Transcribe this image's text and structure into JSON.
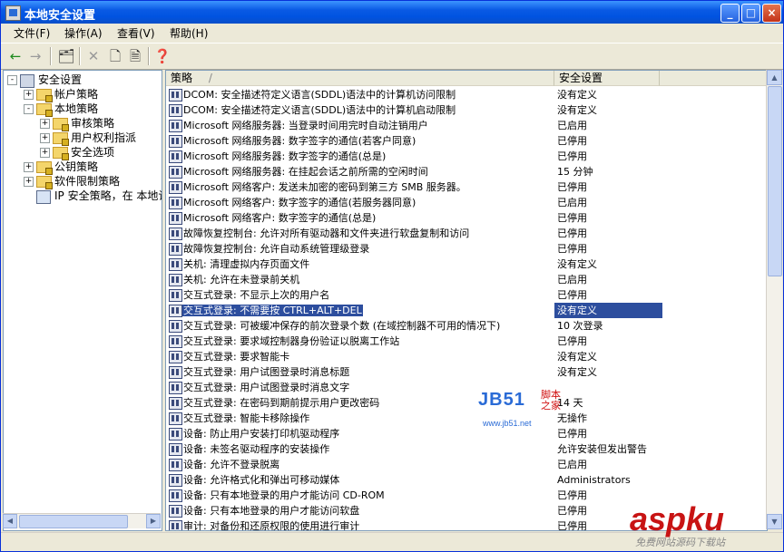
{
  "window": {
    "title": "本地安全设置"
  },
  "menu": [
    "文件(F)",
    "操作(A)",
    "查看(V)",
    "帮助(H)"
  ],
  "tree": [
    {
      "label": "安全设置",
      "level": 0,
      "expander": "-"
    },
    {
      "label": "帐户策略",
      "level": 1,
      "expander": "+"
    },
    {
      "label": "本地策略",
      "level": 1,
      "expander": "-"
    },
    {
      "label": "审核策略",
      "level": 2,
      "expander": "+"
    },
    {
      "label": "用户权利指派",
      "level": 2,
      "expander": "+"
    },
    {
      "label": "安全选项",
      "level": 2,
      "expander": "+"
    },
    {
      "label": "公钥策略",
      "level": 1,
      "expander": "+"
    },
    {
      "label": "软件限制策略",
      "level": 1,
      "expander": "+"
    },
    {
      "label": "IP 安全策略，在 本地计",
      "level": 1,
      "expander": ""
    }
  ],
  "columns": {
    "policy": "策略",
    "sort_indicator": "/",
    "setting": "安全设置"
  },
  "rows": [
    {
      "policy": "DCOM: 安全描述符定义语言(SDDL)语法中的计算机访问限制",
      "setting": "没有定义"
    },
    {
      "policy": "DCOM: 安全描述符定义语言(SDDL)语法中的计算机启动限制",
      "setting": "没有定义"
    },
    {
      "policy": "Microsoft 网络服务器: 当登录时间用完时自动注销用户",
      "setting": "已启用"
    },
    {
      "policy": "Microsoft 网络服务器: 数字签字的通信(若客户同意)",
      "setting": "已停用"
    },
    {
      "policy": "Microsoft 网络服务器: 数字签字的通信(总是)",
      "setting": "已停用"
    },
    {
      "policy": "Microsoft 网络服务器: 在挂起会话之前所需的空闲时间",
      "setting": "15 分钟"
    },
    {
      "policy": "Microsoft 网络客户: 发送未加密的密码到第三方 SMB 服务器。",
      "setting": "已停用"
    },
    {
      "policy": "Microsoft 网络客户: 数字签字的通信(若服务器同意)",
      "setting": "已启用"
    },
    {
      "policy": "Microsoft 网络客户: 数字签字的通信(总是)",
      "setting": "已停用"
    },
    {
      "policy": "故障恢复控制台: 允许对所有驱动器和文件夹进行软盘复制和访问",
      "setting": "已停用"
    },
    {
      "policy": "故障恢复控制台: 允许自动系统管理级登录",
      "setting": "已停用"
    },
    {
      "policy": "关机: 清理虚拟内存页面文件",
      "setting": "没有定义"
    },
    {
      "policy": "关机: 允许在未登录前关机",
      "setting": "已启用"
    },
    {
      "policy": "交互式登录: 不显示上次的用户名",
      "setting": "已停用"
    },
    {
      "policy": "交互式登录: 不需要按 CTRL+ALT+DEL",
      "setting": "没有定义",
      "selected": true
    },
    {
      "policy": "交互式登录: 可被缓冲保存的前次登录个数 (在域控制器不可用的情况下)",
      "setting": "10 次登录"
    },
    {
      "policy": "交互式登录: 要求域控制器身份验证以脱离工作站",
      "setting": "已停用"
    },
    {
      "policy": "交互式登录: 要求智能卡",
      "setting": "没有定义"
    },
    {
      "policy": "交互式登录: 用户试图登录时消息标题",
      "setting": "没有定义"
    },
    {
      "policy": "交互式登录: 用户试图登录时消息文字",
      "setting": ""
    },
    {
      "policy": "交互式登录: 在密码到期前提示用户更改密码",
      "setting": "14 天"
    },
    {
      "policy": "交互式登录: 智能卡移除操作",
      "setting": "无操作"
    },
    {
      "policy": "设备: 防止用户安装打印机驱动程序",
      "setting": "已停用"
    },
    {
      "policy": "设备: 未签名驱动程序的安装操作",
      "setting": "允许安装但发出警告"
    },
    {
      "policy": "设备: 允许不登录脱离",
      "setting": "已启用"
    },
    {
      "policy": "设备: 允许格式化和弹出可移动媒体",
      "setting": "Administrators"
    },
    {
      "policy": "设备: 只有本地登录的用户才能访问 CD-ROM",
      "setting": "已停用"
    },
    {
      "policy": "设备: 只有本地登录的用户才能访问软盘",
      "setting": "已停用"
    },
    {
      "policy": "审计: 对备份和还原权限的使用进行审计",
      "setting": "已停用"
    }
  ],
  "watermarks": {
    "jb51_logo": "JB51",
    "jb51_cn_top": "脚本",
    "jb51_cn_bottom": "之家",
    "jb51_url": "www.jb51.net",
    "aspku_logo": "aspku",
    "aspku_tagline": "免费网站源码下载站"
  },
  "colors": {
    "title_bar": "#0a5ae4",
    "selection": "#2d4e9e"
  }
}
